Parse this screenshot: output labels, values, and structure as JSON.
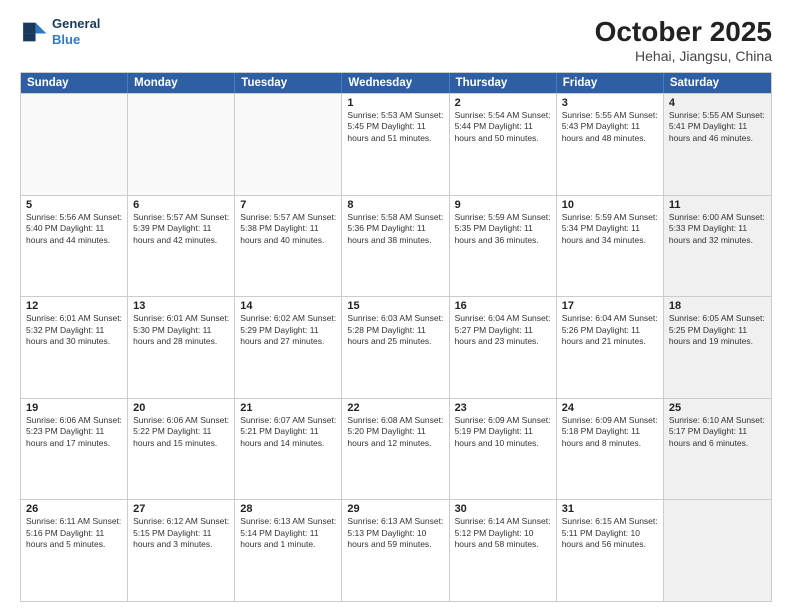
{
  "header": {
    "logo_line1": "General",
    "logo_line2": "Blue",
    "month_title": "October 2025",
    "location": "Hehai, Jiangsu, China"
  },
  "day_headers": [
    "Sunday",
    "Monday",
    "Tuesday",
    "Wednesday",
    "Thursday",
    "Friday",
    "Saturday"
  ],
  "rows": [
    [
      {
        "date": "",
        "info": "",
        "empty": true
      },
      {
        "date": "",
        "info": "",
        "empty": true
      },
      {
        "date": "",
        "info": "",
        "empty": true
      },
      {
        "date": "1",
        "info": "Sunrise: 5:53 AM\nSunset: 5:45 PM\nDaylight: 11 hours\nand 51 minutes.",
        "empty": false
      },
      {
        "date": "2",
        "info": "Sunrise: 5:54 AM\nSunset: 5:44 PM\nDaylight: 11 hours\nand 50 minutes.",
        "empty": false
      },
      {
        "date": "3",
        "info": "Sunrise: 5:55 AM\nSunset: 5:43 PM\nDaylight: 11 hours\nand 48 minutes.",
        "empty": false
      },
      {
        "date": "4",
        "info": "Sunrise: 5:55 AM\nSunset: 5:41 PM\nDaylight: 11 hours\nand 46 minutes.",
        "empty": false,
        "shaded": true
      }
    ],
    [
      {
        "date": "5",
        "info": "Sunrise: 5:56 AM\nSunset: 5:40 PM\nDaylight: 11 hours\nand 44 minutes.",
        "empty": false
      },
      {
        "date": "6",
        "info": "Sunrise: 5:57 AM\nSunset: 5:39 PM\nDaylight: 11 hours\nand 42 minutes.",
        "empty": false
      },
      {
        "date": "7",
        "info": "Sunrise: 5:57 AM\nSunset: 5:38 PM\nDaylight: 11 hours\nand 40 minutes.",
        "empty": false
      },
      {
        "date": "8",
        "info": "Sunrise: 5:58 AM\nSunset: 5:36 PM\nDaylight: 11 hours\nand 38 minutes.",
        "empty": false
      },
      {
        "date": "9",
        "info": "Sunrise: 5:59 AM\nSunset: 5:35 PM\nDaylight: 11 hours\nand 36 minutes.",
        "empty": false
      },
      {
        "date": "10",
        "info": "Sunrise: 5:59 AM\nSunset: 5:34 PM\nDaylight: 11 hours\nand 34 minutes.",
        "empty": false
      },
      {
        "date": "11",
        "info": "Sunrise: 6:00 AM\nSunset: 5:33 PM\nDaylight: 11 hours\nand 32 minutes.",
        "empty": false,
        "shaded": true
      }
    ],
    [
      {
        "date": "12",
        "info": "Sunrise: 6:01 AM\nSunset: 5:32 PM\nDaylight: 11 hours\nand 30 minutes.",
        "empty": false
      },
      {
        "date": "13",
        "info": "Sunrise: 6:01 AM\nSunset: 5:30 PM\nDaylight: 11 hours\nand 28 minutes.",
        "empty": false
      },
      {
        "date": "14",
        "info": "Sunrise: 6:02 AM\nSunset: 5:29 PM\nDaylight: 11 hours\nand 27 minutes.",
        "empty": false
      },
      {
        "date": "15",
        "info": "Sunrise: 6:03 AM\nSunset: 5:28 PM\nDaylight: 11 hours\nand 25 minutes.",
        "empty": false
      },
      {
        "date": "16",
        "info": "Sunrise: 6:04 AM\nSunset: 5:27 PM\nDaylight: 11 hours\nand 23 minutes.",
        "empty": false
      },
      {
        "date": "17",
        "info": "Sunrise: 6:04 AM\nSunset: 5:26 PM\nDaylight: 11 hours\nand 21 minutes.",
        "empty": false
      },
      {
        "date": "18",
        "info": "Sunrise: 6:05 AM\nSunset: 5:25 PM\nDaylight: 11 hours\nand 19 minutes.",
        "empty": false,
        "shaded": true
      }
    ],
    [
      {
        "date": "19",
        "info": "Sunrise: 6:06 AM\nSunset: 5:23 PM\nDaylight: 11 hours\nand 17 minutes.",
        "empty": false
      },
      {
        "date": "20",
        "info": "Sunrise: 6:06 AM\nSunset: 5:22 PM\nDaylight: 11 hours\nand 15 minutes.",
        "empty": false
      },
      {
        "date": "21",
        "info": "Sunrise: 6:07 AM\nSunset: 5:21 PM\nDaylight: 11 hours\nand 14 minutes.",
        "empty": false
      },
      {
        "date": "22",
        "info": "Sunrise: 6:08 AM\nSunset: 5:20 PM\nDaylight: 11 hours\nand 12 minutes.",
        "empty": false
      },
      {
        "date": "23",
        "info": "Sunrise: 6:09 AM\nSunset: 5:19 PM\nDaylight: 11 hours\nand 10 minutes.",
        "empty": false
      },
      {
        "date": "24",
        "info": "Sunrise: 6:09 AM\nSunset: 5:18 PM\nDaylight: 11 hours\nand 8 minutes.",
        "empty": false
      },
      {
        "date": "25",
        "info": "Sunrise: 6:10 AM\nSunset: 5:17 PM\nDaylight: 11 hours\nand 6 minutes.",
        "empty": false,
        "shaded": true
      }
    ],
    [
      {
        "date": "26",
        "info": "Sunrise: 6:11 AM\nSunset: 5:16 PM\nDaylight: 11 hours\nand 5 minutes.",
        "empty": false
      },
      {
        "date": "27",
        "info": "Sunrise: 6:12 AM\nSunset: 5:15 PM\nDaylight: 11 hours\nand 3 minutes.",
        "empty": false
      },
      {
        "date": "28",
        "info": "Sunrise: 6:13 AM\nSunset: 5:14 PM\nDaylight: 11 hours\nand 1 minute.",
        "empty": false
      },
      {
        "date": "29",
        "info": "Sunrise: 6:13 AM\nSunset: 5:13 PM\nDaylight: 10 hours\nand 59 minutes.",
        "empty": false
      },
      {
        "date": "30",
        "info": "Sunrise: 6:14 AM\nSunset: 5:12 PM\nDaylight: 10 hours\nand 58 minutes.",
        "empty": false
      },
      {
        "date": "31",
        "info": "Sunrise: 6:15 AM\nSunset: 5:11 PM\nDaylight: 10 hours\nand 56 minutes.",
        "empty": false
      },
      {
        "date": "",
        "info": "",
        "empty": true,
        "shaded": true
      }
    ]
  ]
}
